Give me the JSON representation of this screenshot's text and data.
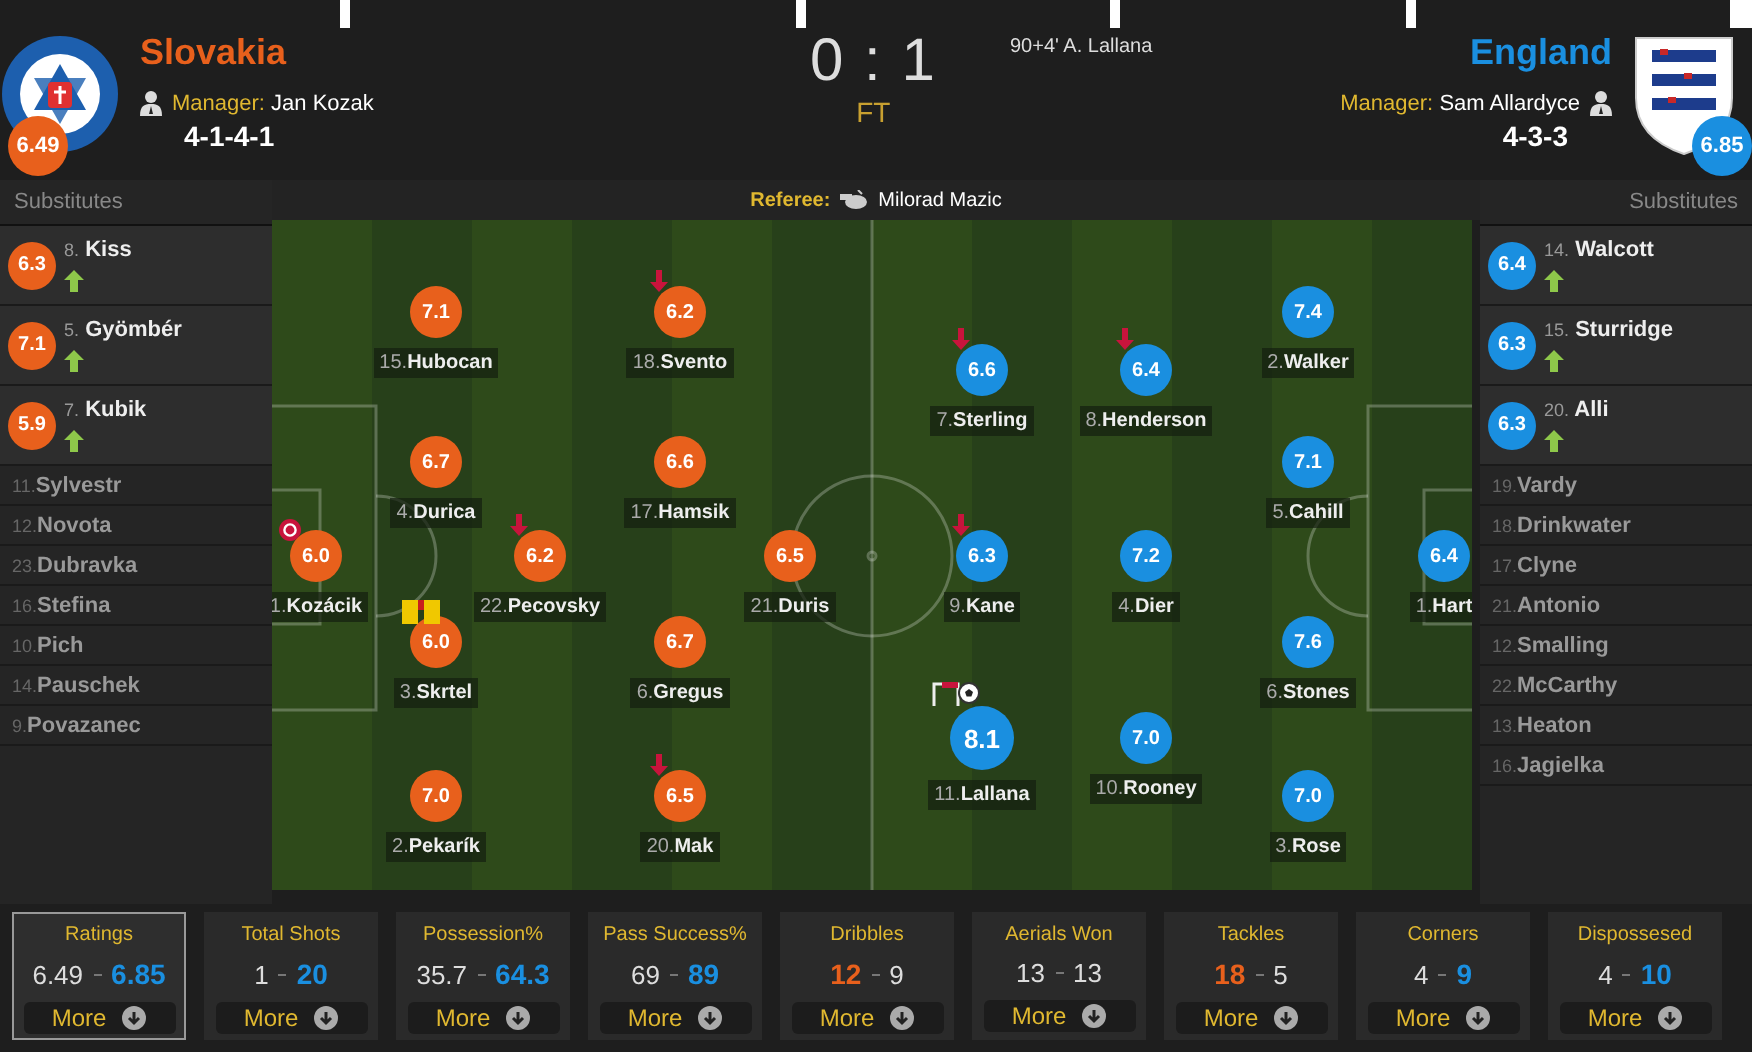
{
  "tabs": [
    {
      "selected": false
    },
    {
      "selected": false
    },
    {
      "selected": false
    },
    {
      "selected": false
    },
    {
      "selected": false
    }
  ],
  "match": {
    "score": "0 : 1",
    "status": "FT",
    "events": [
      {
        "text": "90+4' A. Lallana"
      }
    ],
    "referee_label": "Referee:",
    "referee": "Milorad Mazic"
  },
  "teams": [
    {
      "name": "Slovakia",
      "color": "#e8601c",
      "rating": "6.49",
      "manager_label": "Manager:",
      "manager": "Jan Kozak",
      "formation": "4-1-4-1",
      "substitutes_title": "Substitutes",
      "lines": [
        [
          {
            "number": "1.",
            "name": "Kozácik",
            "rating": "6.0",
            "events": [
              {
                "kind": "error"
              }
            ]
          }
        ],
        [
          {
            "number": "15.",
            "name": "Hubocan",
            "rating": "7.1"
          },
          {
            "number": "4.",
            "name": "Durica",
            "rating": "6.7"
          },
          {
            "number": "3.",
            "name": "Skrtel",
            "rating": "6.0",
            "events": [
              {
                "kind": "yellow_card"
              }
            ]
          },
          {
            "number": "2.",
            "name": "Pekarík",
            "rating": "7.0"
          }
        ],
        [
          {
            "number": "22.",
            "name": "Pecovsky",
            "rating": "6.2",
            "events": [
              {
                "kind": "subbed_off"
              }
            ]
          }
        ],
        [
          {
            "number": "18.",
            "name": "Svento",
            "rating": "6.2",
            "events": [
              {
                "kind": "subbed_off"
              }
            ]
          },
          {
            "number": "17.",
            "name": "Hamsik",
            "rating": "6.6"
          },
          {
            "number": "6.",
            "name": "Gregus",
            "rating": "6.7"
          },
          {
            "number": "20.",
            "name": "Mak",
            "rating": "6.5",
            "events": [
              {
                "kind": "subbed_off"
              }
            ]
          }
        ],
        [
          {
            "number": "21.",
            "name": "Duris",
            "rating": "6.5"
          }
        ]
      ],
      "substitutes": [
        {
          "number": "8.",
          "name": "Kiss",
          "rating": "6.3",
          "subbed_on": true
        },
        {
          "number": "5.",
          "name": "Gyömbér",
          "rating": "7.1",
          "subbed_on": true
        },
        {
          "number": "7.",
          "name": "Kubik",
          "rating": "5.9",
          "subbed_on": true
        },
        {
          "number": "11.",
          "name": "Sylvestr",
          "subbed_on": false
        },
        {
          "number": "12.",
          "name": "Novota",
          "subbed_on": false
        },
        {
          "number": "23.",
          "name": "Dubravka",
          "subbed_on": false
        },
        {
          "number": "16.",
          "name": "Stefina",
          "subbed_on": false
        },
        {
          "number": "10.",
          "name": "Pich",
          "subbed_on": false
        },
        {
          "number": "14.",
          "name": "Pauschek",
          "subbed_on": false
        },
        {
          "number": "9.",
          "name": "Povazanec",
          "subbed_on": false
        }
      ]
    },
    {
      "name": "England",
      "color": "#1a8fe0",
      "rating": "6.85",
      "manager_label": "Manager:",
      "manager": "Sam Allardyce",
      "formation": "4-3-3",
      "substitutes_title": "Substitutes",
      "lines": [
        [
          {
            "number": "7.",
            "name": "Sterling",
            "rating": "6.6",
            "events": [
              {
                "kind": "subbed_off"
              }
            ]
          },
          {
            "number": "9.",
            "name": "Kane",
            "rating": "6.3",
            "events": [
              {
                "kind": "subbed_off"
              }
            ]
          },
          {
            "number": "11.",
            "name": "Lallana",
            "rating": "8.1",
            "events": [
              {
                "kind": "woodwork"
              },
              {
                "kind": "goal"
              }
            ]
          }
        ],
        [
          {
            "number": "8.",
            "name": "Henderson",
            "rating": "6.4",
            "events": [
              {
                "kind": "subbed_off"
              }
            ]
          },
          {
            "number": "4.",
            "name": "Dier",
            "rating": "7.2"
          },
          {
            "number": "10.",
            "name": "Rooney",
            "rating": "7.0"
          }
        ],
        [
          {
            "number": "2.",
            "name": "Walker",
            "rating": "7.4"
          },
          {
            "number": "5.",
            "name": "Cahill",
            "rating": "7.1"
          },
          {
            "number": "6.",
            "name": "Stones",
            "rating": "7.6"
          },
          {
            "number": "3.",
            "name": "Rose",
            "rating": "7.0"
          }
        ],
        [
          {
            "number": "1.",
            "name": "Hart",
            "rating": "6.4"
          }
        ]
      ],
      "substitutes": [
        {
          "number": "14.",
          "name": "Walcott",
          "rating": "6.4",
          "subbed_on": true
        },
        {
          "number": "15.",
          "name": "Sturridge",
          "rating": "6.3",
          "subbed_on": true
        },
        {
          "number": "20.",
          "name": "Alli",
          "rating": "6.3",
          "subbed_on": true
        },
        {
          "number": "19.",
          "name": "Vardy",
          "subbed_on": false
        },
        {
          "number": "18.",
          "name": "Drinkwater",
          "subbed_on": false
        },
        {
          "number": "17.",
          "name": "Clyne",
          "subbed_on": false
        },
        {
          "number": "21.",
          "name": "Antonio",
          "subbed_on": false
        },
        {
          "number": "12.",
          "name": "Smalling",
          "subbed_on": false
        },
        {
          "number": "22.",
          "name": "McCarthy",
          "subbed_on": false
        },
        {
          "number": "13.",
          "name": "Heaton",
          "subbed_on": false
        },
        {
          "number": "16.",
          "name": "Jagielka",
          "subbed_on": false
        }
      ]
    }
  ],
  "stats": [
    {
      "title": "Ratings",
      "home": "6.49",
      "away": "6.85",
      "home_lead": false,
      "away_lead": true,
      "selected": true,
      "button": "More"
    },
    {
      "title": "Total Shots",
      "home": "1",
      "away": "20",
      "home_lead": false,
      "away_lead": true,
      "selected": false,
      "button": "More"
    },
    {
      "title": "Possession%",
      "home": "35.7",
      "away": "64.3",
      "home_lead": false,
      "away_lead": true,
      "selected": false,
      "button": "More"
    },
    {
      "title": "Pass Success%",
      "home": "69",
      "away": "89",
      "home_lead": false,
      "away_lead": true,
      "selected": false,
      "button": "More"
    },
    {
      "title": "Dribbles",
      "home": "12",
      "away": "9",
      "home_lead": true,
      "away_lead": false,
      "selected": false,
      "button": "More"
    },
    {
      "title": "Aerials Won",
      "home": "13",
      "away": "13",
      "home_lead": false,
      "away_lead": false,
      "selected": false,
      "button": "More"
    },
    {
      "title": "Tackles",
      "home": "18",
      "away": "5",
      "home_lead": true,
      "away_lead": false,
      "selected": false,
      "button": "More"
    },
    {
      "title": "Corners",
      "home": "4",
      "away": "9",
      "home_lead": false,
      "away_lead": true,
      "selected": false,
      "button": "More"
    },
    {
      "title": "Dispossesed",
      "home": "4",
      "away": "10",
      "home_lead": false,
      "away_lead": true,
      "selected": false,
      "button": "More"
    }
  ]
}
